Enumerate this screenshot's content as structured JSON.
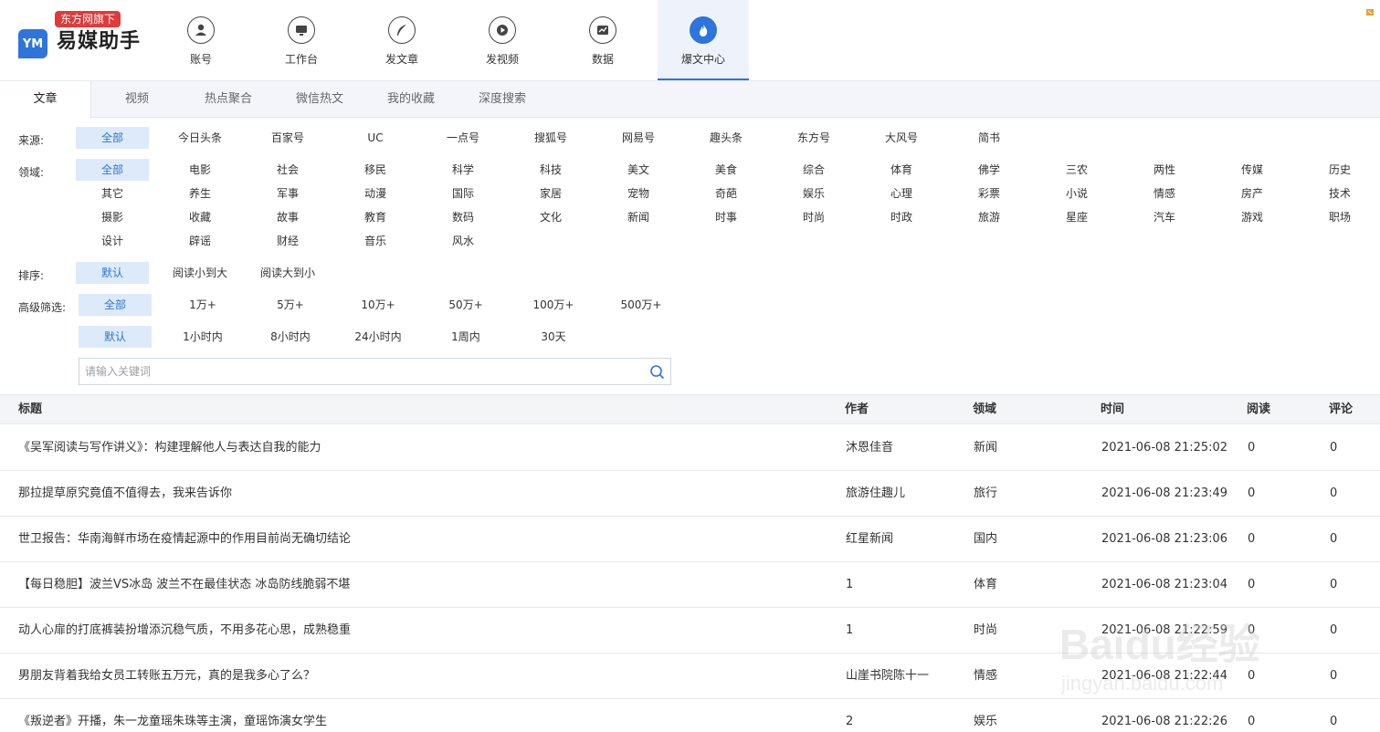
{
  "app": {
    "logo_badge": "东方网旗下",
    "logo_mark": "YM",
    "logo_name": "易媒助手"
  },
  "nav": [
    {
      "label": "账号",
      "icon": "user-icon"
    },
    {
      "label": "工作台",
      "icon": "monitor-icon"
    },
    {
      "label": "发文章",
      "icon": "feather-icon"
    },
    {
      "label": "发视频",
      "icon": "play-icon"
    },
    {
      "label": "数据",
      "icon": "chart-icon"
    },
    {
      "label": "爆文中心",
      "icon": "flame-icon",
      "active": true
    }
  ],
  "tabs": [
    "文章",
    "视频",
    "热点聚合",
    "微信热文",
    "我的收藏",
    "深度搜索"
  ],
  "filters": {
    "source_label": "来源:",
    "sources": [
      "全部",
      "今日头条",
      "百家号",
      "UC",
      "一点号",
      "搜狐号",
      "网易号",
      "趣头条",
      "东方号",
      "大风号",
      "简书"
    ],
    "domain_label": "领域:",
    "domains": [
      "全部",
      "电影",
      "社会",
      "移民",
      "科学",
      "科技",
      "美文",
      "美食",
      "综合",
      "体育",
      "佛学",
      "三农",
      "两性",
      "传媒",
      "历史",
      "其它",
      "养生",
      "军事",
      "动漫",
      "国际",
      "家居",
      "宠物",
      "奇葩",
      "娱乐",
      "心理",
      "彩票",
      "小说",
      "情感",
      "房产",
      "技术",
      "摄影",
      "收藏",
      "故事",
      "教育",
      "数码",
      "文化",
      "新闻",
      "时事",
      "时尚",
      "时政",
      "旅游",
      "星座",
      "汽车",
      "游戏",
      "职场",
      "设计",
      "辟谣",
      "财经",
      "音乐",
      "风水"
    ],
    "sort_label": "排序:",
    "sorts": [
      "默认",
      "阅读小到大",
      "阅读大到小"
    ],
    "advanced_label": "高级筛选:",
    "reads": [
      "全部",
      "1万+",
      "5万+",
      "10万+",
      "50万+",
      "100万+",
      "500万+"
    ],
    "times": [
      "默认",
      "1小时内",
      "8小时内",
      "24小时内",
      "1周内",
      "30天"
    ]
  },
  "search": {
    "placeholder": "请输入关键词"
  },
  "table": {
    "headers": {
      "title": "标题",
      "author": "作者",
      "domain": "领域",
      "time": "时间",
      "reads": "阅读",
      "comments": "评论"
    },
    "rows": [
      {
        "title": "《吴军阅读与写作讲义》：构建理解他人与表达自我的能力",
        "author": "沐恩佳音",
        "domain": "新闻",
        "time": "2021-06-08 21:25:02",
        "reads": "0",
        "comments": "0"
      },
      {
        "title": "那拉提草原究竟值不值得去，我来告诉你",
        "author": "旅游住趣儿",
        "domain": "旅行",
        "time": "2021-06-08 21:23:49",
        "reads": "0",
        "comments": "0"
      },
      {
        "title": "世卫报告：华南海鲜市场在疫情起源中的作用目前尚无确切结论",
        "author": "红星新闻",
        "domain": "国内",
        "time": "2021-06-08 21:23:06",
        "reads": "0",
        "comments": "0"
      },
      {
        "title": "【每日稳胆】波兰VS冰岛 波兰不在最佳状态 冰岛防线脆弱不堪",
        "author": "1",
        "domain": "体育",
        "time": "2021-06-08 21:23:04",
        "reads": "0",
        "comments": "0"
      },
      {
        "title": "动人心扉的打底裤装扮增添沉稳气质，不用多花心思，成熟稳重",
        "author": "1",
        "domain": "时尚",
        "time": "2021-06-08 21:22:59",
        "reads": "0",
        "comments": "0"
      },
      {
        "title": "男朋友背着我给女员工转账五万元，真的是我多心了么？",
        "author": "山崖书院陈十一",
        "domain": "情感",
        "time": "2021-06-08 21:22:44",
        "reads": "0",
        "comments": "0"
      },
      {
        "title": "《叛逆者》开播，朱一龙童瑶朱珠等主演，童瑶饰演女学生",
        "author": "2",
        "domain": "娱乐",
        "time": "2021-06-08 21:22:26",
        "reads": "0",
        "comments": "0"
      }
    ]
  },
  "watermark": {
    "brand": "Baidu经验",
    "url": "jingyan.baidu.com"
  },
  "colors": {
    "accent": "#2d74db",
    "active_bg": "#ddeaf9",
    "badge": "#e03a3a"
  }
}
